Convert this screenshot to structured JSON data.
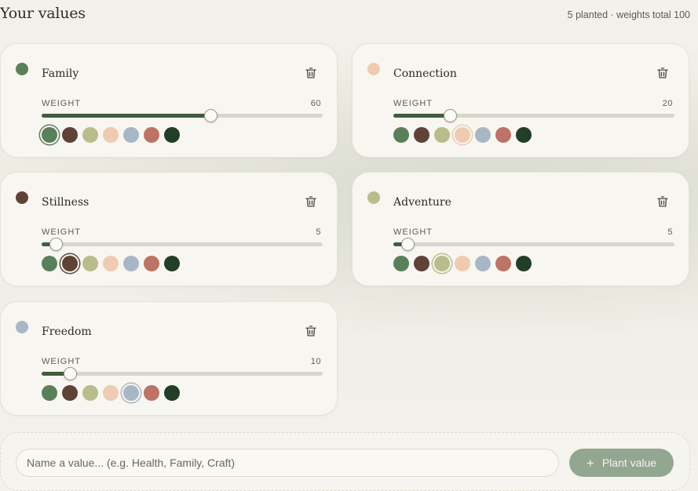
{
  "header": {
    "title": "Your values",
    "summary": "5 planted · weights total 100"
  },
  "weight_label": "WEIGHT",
  "palette": [
    "#5a7f5b",
    "#5e4336",
    "#b8bd8c",
    "#efcbb2",
    "#a8b7c4",
    "#bd7365",
    "#233d26"
  ],
  "weight_max": 100,
  "values": [
    {
      "name": "Family",
      "weight": 60,
      "color_index": 0
    },
    {
      "name": "Connection",
      "weight": 20,
      "color_index": 3
    },
    {
      "name": "Stillness",
      "weight": 5,
      "color_index": 1
    },
    {
      "name": "Adventure",
      "weight": 5,
      "color_index": 2
    },
    {
      "name": "Freedom",
      "weight": 10,
      "color_index": 4
    }
  ],
  "add": {
    "placeholder": "Name a value... (e.g. Health, Family, Craft)",
    "button_label": "Plant value",
    "button_icon": "plus-icon"
  }
}
